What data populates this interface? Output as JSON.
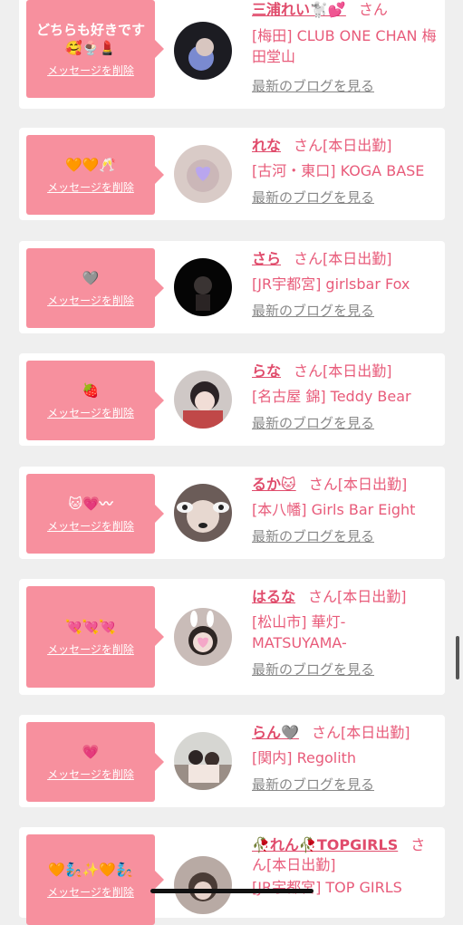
{
  "cards": [
    {
      "message": "どちらも好きです🥰🍨💄",
      "delete": "メッセージを削除",
      "name": "三浦れい🐩💕",
      "san": "さん",
      "status": "",
      "shop": "[梅田] CLUB ONE CHAN 梅田堂山",
      "blog": "最新のブログを見る"
    },
    {
      "message": "🧡🧡🥂",
      "delete": "メッセージを削除",
      "name": "れな",
      "san": "さん",
      "status": "[本日出勤]",
      "shop": "[古河・東口] KOGA BASE",
      "blog": "最新のブログを見る"
    },
    {
      "message": "🩶",
      "delete": "メッセージを削除",
      "name": "さら",
      "san": "さん",
      "status": "[本日出勤]",
      "shop": "[JR宇都宮] girlsbar Fox",
      "blog": "最新のブログを見る"
    },
    {
      "message": "🍓",
      "delete": "メッセージを削除",
      "name": "らな",
      "san": "さん",
      "status": "[本日出勤]",
      "shop": "[名古屋 錦] Teddy Bear",
      "blog": "最新のブログを見る"
    },
    {
      "message": "🐱💗〰",
      "delete": "メッセージを削除",
      "name": "るか🐱",
      "san": "さん",
      "status": "[本日出勤]",
      "shop": "[本八幡] Girls Bar Eight",
      "blog": "最新のブログを見る"
    },
    {
      "message": "💘💘💘",
      "delete": "メッセージを削除",
      "name": "はるな",
      "san": "さん",
      "status": "[本日出勤]",
      "shop": "[松山市] 華灯-MATSUYAMA-",
      "blog": "最新のブログを見る"
    },
    {
      "message": "💗",
      "delete": "メッセージを削除",
      "name": "らん🩶",
      "san": "さん",
      "status": "[本日出勤]",
      "shop": "[関内] Regolith",
      "blog": "最新のブログを見る"
    },
    {
      "message": "🧡🧞✨🧡🧞",
      "delete": "メッセージを削除",
      "name": "🥀れん🥀TOPGIRLS",
      "san": "さん",
      "status": "[本日出勤]",
      "shop": "[JR宇都宮] TOP GIRLS",
      "blog": ""
    }
  ]
}
